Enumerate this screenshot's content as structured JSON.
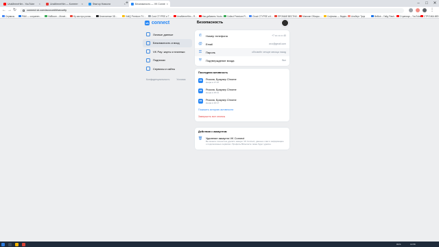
{
  "browser": {
    "tabs": [
      {
        "title": "UnaMemeHim - YouTube",
        "favicon_color": "#ff0000",
        "active": false
      },
      {
        "title": "UnaMemeHim — Контент",
        "favicon_color": "#e53935",
        "active": false
      },
      {
        "title": "Фактор Новости",
        "favicon_color": "#2196f3",
        "active": false
      },
      {
        "title": "Безопасность — VK Connect",
        "favicon_color": "#2787f5",
        "active": true
      }
    ],
    "new_tab_label": "+",
    "url": "connect.vk.com/account/#/security",
    "bookmarks": [
      {
        "label": "Сервисы",
        "color": "#4285f4"
      },
      {
        "label": "PAM — сохранен…",
        "color": "#1a73e8"
      },
      {
        "label": "VidBoom – Monet…",
        "color": "#34a853"
      },
      {
        "label": "Ну как про ролик…",
        "color": "#ea4335"
      },
      {
        "label": "Бесплатные 3D…",
        "color": "#202124"
      },
      {
        "label": "VidIQ Premium TV…",
        "color": "#fbbc04"
      },
      {
        "label": "Cost CTYPEE и Т…",
        "color": "#9aa0a6"
      },
      {
        "label": "UnaMemeHim – Я…",
        "color": "#ff0000"
      },
      {
        "label": "Как добавить Youtu…",
        "color": "#ff0000"
      },
      {
        "label": "Collect Premium Fl…",
        "color": "#34a853"
      },
      {
        "label": "Cloud CTYPEE и К…",
        "color": "#4285f4"
      },
      {
        "label": "ПРОМАЙ ВЕСТНИ…",
        "color": "#ea4335"
      },
      {
        "label": "Магазин Обзоры…",
        "color": "#ea4335"
      },
      {
        "label": "Софтаны — Видео…",
        "color": "#fbbc04"
      },
      {
        "label": "Альберт Тред",
        "color": "#f28b82"
      },
      {
        "label": "BeBob – Гайд Flash…",
        "color": "#1a73e8"
      },
      {
        "label": "Страница – YouTube",
        "color": "#ff0000"
      },
      {
        "label": "СТРОЧКА МЕНЮ",
        "color": "#ff0000"
      }
    ]
  },
  "app": {
    "logo_text": "connect",
    "logo_mark": "vk",
    "page_title": "Безопасность"
  },
  "sidebar": {
    "items": [
      {
        "label": "Личные данные",
        "active": false
      },
      {
        "label": "Безопасность и вход",
        "active": true
      },
      {
        "label": "VK Pay: карты и платежи",
        "active": false
      },
      {
        "label": "Подписки",
        "active": false
      },
      {
        "label": "Сервисы и сайты",
        "active": false
      }
    ],
    "footer_privacy": "Конфиденциальность",
    "footer_terms": "Условия"
  },
  "security": {
    "rows": [
      {
        "label": "Номер телефона",
        "value": "+7 ••• ••• •• 40",
        "icon": "phone-icon",
        "glyph": "✆"
      },
      {
        "label": "Email",
        "value": "w•••@gmail.com",
        "icon": "mail-icon",
        "glyph": "@"
      },
      {
        "label": "Пароль",
        "value": "обновлён четыре месяца назад",
        "icon": "key-icon",
        "glyph": "⚿"
      },
      {
        "label": "Подтверждение входа",
        "value": "Вкл",
        "icon": "shield-icon",
        "glyph": "⛨"
      }
    ]
  },
  "activity": {
    "heading": "Последняя активность",
    "sessions": [
      {
        "title": "Россия, Браузер Chrome",
        "time": "вчера в 17:07"
      },
      {
        "title": "Россия, Браузер Chrome",
        "time": "вчера в 15:11"
      },
      {
        "title": "Россия, Браузер Chrome",
        "time": "вчера в 16:17"
      }
    ],
    "show_history": "Показать историю активности",
    "end_all": "Завершить все сеансы"
  },
  "account_actions": {
    "heading": "Действия с аккаунтом",
    "delete_title": "Удаление аккаунта VK Connect",
    "delete_desc": "Вы можете полностью удалить аккаунт VK Connect, данные о вас и информацию о подключённых сервисах. Профиль ВКонтакте также будет удалён."
  },
  "taskbar": {
    "lang": "RUS",
    "time": "13:58"
  }
}
